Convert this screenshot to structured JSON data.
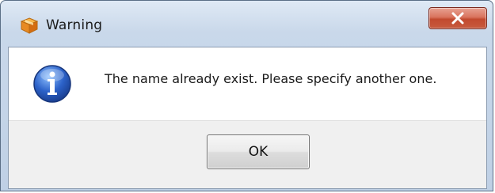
{
  "window": {
    "title": "Warning",
    "app_icon": "package-icon",
    "close_icon": "close-icon",
    "close_color": "#c75a3e"
  },
  "dialog": {
    "icon": "info-icon",
    "message": "The name already exist. Please specify another one.",
    "ok_label": "OK"
  },
  "colors": {
    "frame": "#c9d8ea",
    "button_area": "#f0f0f0",
    "info_blue": "#2c62c9"
  }
}
